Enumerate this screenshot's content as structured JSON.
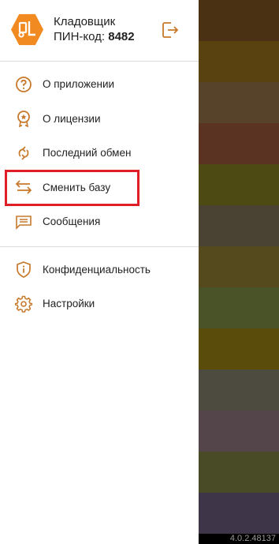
{
  "header": {
    "user_name": "Кладовщик",
    "pin_label": "ПИН-код:",
    "pin_value": "8482",
    "logo_icon": "forklift-logo-icon",
    "logout_icon": "logout-icon"
  },
  "menu_group1": [
    {
      "label": "О приложении",
      "icon": "question-circle-icon"
    },
    {
      "label": "О лицензии",
      "icon": "badge-icon"
    },
    {
      "label": "Последний обмен",
      "icon": "sync-icon"
    },
    {
      "label": "Сменить базу",
      "icon": "swap-arrows-icon"
    },
    {
      "label": "Сообщения",
      "icon": "message-icon"
    }
  ],
  "menu_group2": [
    {
      "label": "Конфиденциальность",
      "icon": "shield-info-icon"
    },
    {
      "label": "Настройки",
      "icon": "gear-icon"
    }
  ],
  "version": "4.0.2.48137",
  "colors": {
    "accent": "#c7792b",
    "logo": "#f28a22",
    "highlight": "#e01e27",
    "backdrop": [
      "#4a3114",
      "#5a4210",
      "#56432a",
      "#5a3323",
      "#4d4a13",
      "#4a4232",
      "#554a1e",
      "#4a5228",
      "#5a4d0b",
      "#4d4a3f",
      "#53454a",
      "#494a26",
      "#3f3549"
    ]
  }
}
